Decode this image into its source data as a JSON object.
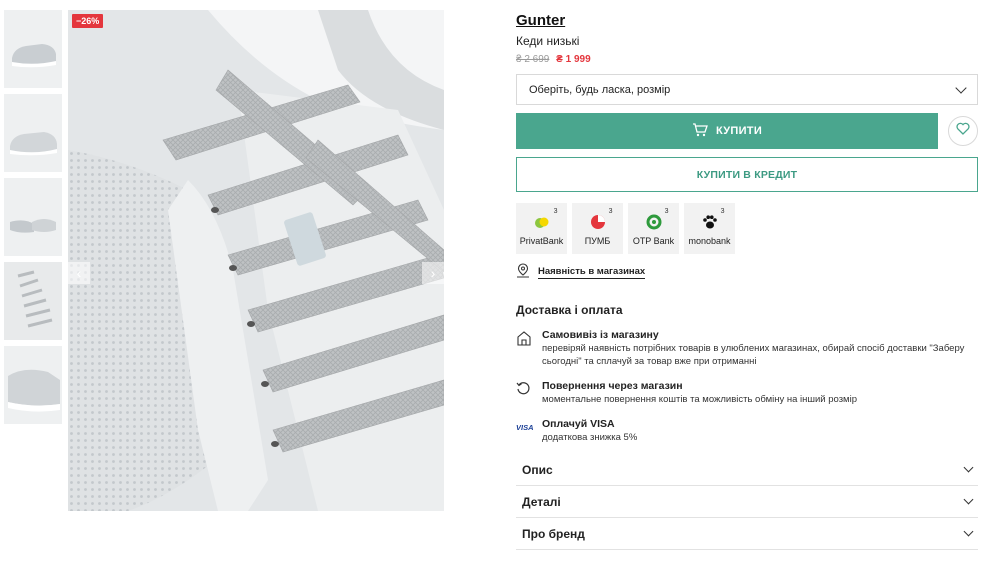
{
  "gallery": {
    "discount_badge": "−26%",
    "thumbnails": [
      "thumb-1",
      "thumb-2",
      "thumb-3",
      "thumb-4",
      "thumb-5"
    ],
    "active_thumbnail_index": 3
  },
  "product": {
    "brand": "Gunter",
    "type": "Кеди низькі",
    "old_price": "₴ 2 699",
    "new_price": "₴ 1 999"
  },
  "size_select": {
    "placeholder": "Оберіть, будь ласка, розмір"
  },
  "buttons": {
    "buy": "КУПИТИ",
    "credit": "КУПИТИ В КРЕДИТ"
  },
  "banks": [
    {
      "name": "PrivatBank",
      "sup": "3"
    },
    {
      "name": "ПУМБ",
      "sup": "3"
    },
    {
      "name": "OTP Bank",
      "sup": "3"
    },
    {
      "name": "monobank",
      "sup": "3"
    }
  ],
  "stores_link": "Наявність в магазинах",
  "delivery": {
    "title": "Доставка і оплата",
    "items": [
      {
        "icon": "store-icon",
        "title": "Самовивіз із магазину",
        "text": "перевіряй наявність потрібних товарів в улюблених магазинах, обирай спосіб доставки \"Заберу сьогодні\" та сплачуй за товар вже при отриманні"
      },
      {
        "icon": "return-icon",
        "title": "Повернення через магазин",
        "text": "моментальне повернення коштів та можливість обміну на інший розмір"
      },
      {
        "icon": "visa-icon",
        "title": "Оплачуй VISA",
        "text": "додаткова знижка 5%"
      }
    ]
  },
  "accordion": [
    "Опис",
    "Деталі",
    "Про бренд"
  ],
  "colors": {
    "accent": "#4aa68e",
    "sale": "#e4363d"
  }
}
